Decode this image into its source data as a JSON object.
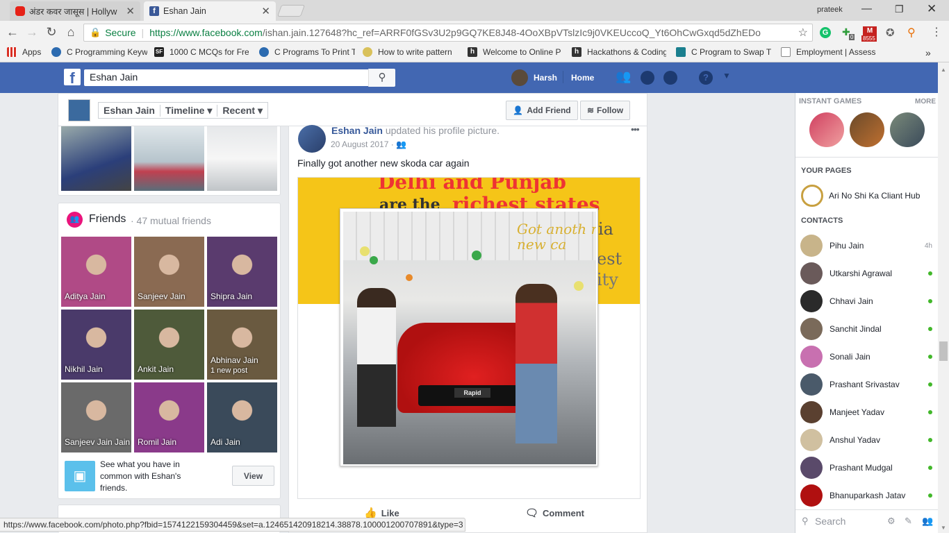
{
  "browser": {
    "tabs": [
      {
        "title": "अंडर कवर जासूस | Hollyw",
        "active": false
      },
      {
        "title": "Eshan Jain",
        "active": true
      }
    ],
    "profile_name": "prateek",
    "secure_label": "Secure",
    "url_host": "https://www.facebook.com",
    "url_path": "/ishan.jain.127648?hc_ref=ARRF0fGSv3U2p9GQ7KE8J48-4OoXBpVTslzIc9j0VKEUccoQ_Yt6OhCwGxqd5dZhEDo",
    "mail_badge": "8555",
    "ext_badge": "0",
    "bookmarks": [
      "Apps",
      "C Programming Keyw",
      "1000 C MCQs for Fre",
      "C Programs To Print T",
      "How to write pattern",
      "Welcome to Online P",
      "Hackathons & Coding",
      "C Program to Swap T",
      "Employment | Assess"
    ],
    "status_url": "https://www.facebook.com/photo.php?fbid=1574122159304459&set=a.124651420918214.38878.100001200707891&type=3"
  },
  "fb": {
    "search_value": "Eshan Jain",
    "user_name": "Harsh",
    "home_label": "Home",
    "profile_nav": {
      "name": "Eshan Jain",
      "timeline": "Timeline",
      "recent": "Recent",
      "add_friend": "Add Friend",
      "follow": "Follow"
    },
    "friends": {
      "title": "Friends",
      "subtitle": "· 47 mutual friends",
      "list": [
        {
          "name": "Aditya Jain",
          "color": "#b04a86"
        },
        {
          "name": "Sanjeev Jain",
          "color": "#8a6a52"
        },
        {
          "name": "Shipra Jain",
          "color": "#5a3b6e"
        },
        {
          "name": "Nikhil Jain",
          "color": "#4a3a6a"
        },
        {
          "name": "Ankit Jain",
          "color": "#4e5a3a"
        },
        {
          "name": "Abhinav Jain",
          "sub": "1 new post",
          "color": "#6a5a40"
        },
        {
          "name": "Sanjeev Jain Jain",
          "color": "#6a6a6a"
        },
        {
          "name": "Romil Jain",
          "color": "#8a3a8a"
        },
        {
          "name": "Adi Jain",
          "color": "#3a4a5a"
        }
      ],
      "common_text": "See what you have in common with Eshan's friends.",
      "view_label": "View"
    },
    "post": {
      "author": "Eshan Jain",
      "action": "updated his profile picture.",
      "date": "20 August 2017 ·",
      "text": "Finally got another new skoda car again",
      "banner_line1": "Delhi and Punjab",
      "banner_line2_a": "are the",
      "banner_line2_b": "richest states",
      "banner_right1": "ia",
      "banner_right2": "est",
      "banner_right3": "ity",
      "overlay_text": "Got anoth r new ca",
      "plate_text": "Rapid",
      "like_label": "Like",
      "comment_label": "Comment"
    },
    "sidebar": {
      "instant_games": "INSTANT GAMES",
      "more": "MORE",
      "your_pages": "YOUR PAGES",
      "page_name": "Ari No Shi Ka Cliant Hub",
      "contacts_title": "CONTACTS",
      "contacts": [
        {
          "name": "Pihu Jain",
          "status": "4h",
          "color": "#c8b48a"
        },
        {
          "name": "Utkarshi Agrawal",
          "status": "online",
          "color": "#6a5a5a"
        },
        {
          "name": "Chhavi Jain",
          "status": "online",
          "color": "#2a2a2a"
        },
        {
          "name": "Sanchit Jindal",
          "status": "online",
          "color": "#7a6a5a"
        },
        {
          "name": "Sonali Jain",
          "status": "online",
          "color": "#c870b0"
        },
        {
          "name": "Prashant Srivastav",
          "status": "online",
          "color": "#4a5a6a"
        },
        {
          "name": "Manjeet Yadav",
          "status": "online",
          "color": "#5a4030"
        },
        {
          "name": "Anshul Yadav",
          "status": "online",
          "color": "#d0c0a0"
        },
        {
          "name": "Prashant Mudgal",
          "status": "online",
          "color": "#5a4a6a"
        },
        {
          "name": "Bhanuparkash Jatav",
          "status": "online",
          "color": "#b01010"
        }
      ],
      "search_placeholder": "Search"
    }
  }
}
